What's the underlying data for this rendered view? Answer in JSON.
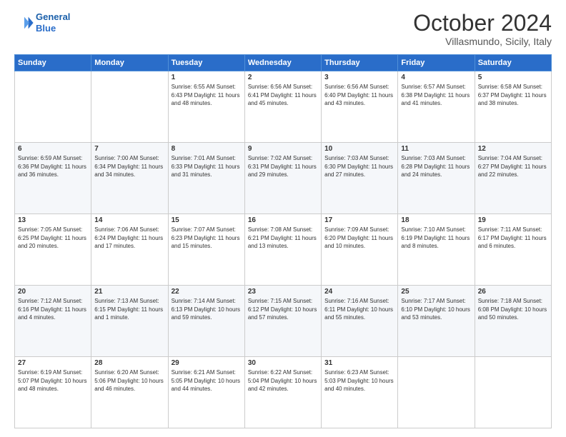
{
  "header": {
    "logo_line1": "General",
    "logo_line2": "Blue",
    "month": "October 2024",
    "location": "Villasmundo, Sicily, Italy"
  },
  "weekdays": [
    "Sunday",
    "Monday",
    "Tuesday",
    "Wednesday",
    "Thursday",
    "Friday",
    "Saturday"
  ],
  "weeks": [
    [
      {
        "day": "",
        "content": ""
      },
      {
        "day": "",
        "content": ""
      },
      {
        "day": "1",
        "content": "Sunrise: 6:55 AM\nSunset: 6:43 PM\nDaylight: 11 hours and 48 minutes."
      },
      {
        "day": "2",
        "content": "Sunrise: 6:56 AM\nSunset: 6:41 PM\nDaylight: 11 hours and 45 minutes."
      },
      {
        "day": "3",
        "content": "Sunrise: 6:56 AM\nSunset: 6:40 PM\nDaylight: 11 hours and 43 minutes."
      },
      {
        "day": "4",
        "content": "Sunrise: 6:57 AM\nSunset: 6:38 PM\nDaylight: 11 hours and 41 minutes."
      },
      {
        "day": "5",
        "content": "Sunrise: 6:58 AM\nSunset: 6:37 PM\nDaylight: 11 hours and 38 minutes."
      }
    ],
    [
      {
        "day": "6",
        "content": "Sunrise: 6:59 AM\nSunset: 6:36 PM\nDaylight: 11 hours and 36 minutes."
      },
      {
        "day": "7",
        "content": "Sunrise: 7:00 AM\nSunset: 6:34 PM\nDaylight: 11 hours and 34 minutes."
      },
      {
        "day": "8",
        "content": "Sunrise: 7:01 AM\nSunset: 6:33 PM\nDaylight: 11 hours and 31 minutes."
      },
      {
        "day": "9",
        "content": "Sunrise: 7:02 AM\nSunset: 6:31 PM\nDaylight: 11 hours and 29 minutes."
      },
      {
        "day": "10",
        "content": "Sunrise: 7:03 AM\nSunset: 6:30 PM\nDaylight: 11 hours and 27 minutes."
      },
      {
        "day": "11",
        "content": "Sunrise: 7:03 AM\nSunset: 6:28 PM\nDaylight: 11 hours and 24 minutes."
      },
      {
        "day": "12",
        "content": "Sunrise: 7:04 AM\nSunset: 6:27 PM\nDaylight: 11 hours and 22 minutes."
      }
    ],
    [
      {
        "day": "13",
        "content": "Sunrise: 7:05 AM\nSunset: 6:25 PM\nDaylight: 11 hours and 20 minutes."
      },
      {
        "day": "14",
        "content": "Sunrise: 7:06 AM\nSunset: 6:24 PM\nDaylight: 11 hours and 17 minutes."
      },
      {
        "day": "15",
        "content": "Sunrise: 7:07 AM\nSunset: 6:23 PM\nDaylight: 11 hours and 15 minutes."
      },
      {
        "day": "16",
        "content": "Sunrise: 7:08 AM\nSunset: 6:21 PM\nDaylight: 11 hours and 13 minutes."
      },
      {
        "day": "17",
        "content": "Sunrise: 7:09 AM\nSunset: 6:20 PM\nDaylight: 11 hours and 10 minutes."
      },
      {
        "day": "18",
        "content": "Sunrise: 7:10 AM\nSunset: 6:19 PM\nDaylight: 11 hours and 8 minutes."
      },
      {
        "day": "19",
        "content": "Sunrise: 7:11 AM\nSunset: 6:17 PM\nDaylight: 11 hours and 6 minutes."
      }
    ],
    [
      {
        "day": "20",
        "content": "Sunrise: 7:12 AM\nSunset: 6:16 PM\nDaylight: 11 hours and 4 minutes."
      },
      {
        "day": "21",
        "content": "Sunrise: 7:13 AM\nSunset: 6:15 PM\nDaylight: 11 hours and 1 minute."
      },
      {
        "day": "22",
        "content": "Sunrise: 7:14 AM\nSunset: 6:13 PM\nDaylight: 10 hours and 59 minutes."
      },
      {
        "day": "23",
        "content": "Sunrise: 7:15 AM\nSunset: 6:12 PM\nDaylight: 10 hours and 57 minutes."
      },
      {
        "day": "24",
        "content": "Sunrise: 7:16 AM\nSunset: 6:11 PM\nDaylight: 10 hours and 55 minutes."
      },
      {
        "day": "25",
        "content": "Sunrise: 7:17 AM\nSunset: 6:10 PM\nDaylight: 10 hours and 53 minutes."
      },
      {
        "day": "26",
        "content": "Sunrise: 7:18 AM\nSunset: 6:08 PM\nDaylight: 10 hours and 50 minutes."
      }
    ],
    [
      {
        "day": "27",
        "content": "Sunrise: 6:19 AM\nSunset: 5:07 PM\nDaylight: 10 hours and 48 minutes."
      },
      {
        "day": "28",
        "content": "Sunrise: 6:20 AM\nSunset: 5:06 PM\nDaylight: 10 hours and 46 minutes."
      },
      {
        "day": "29",
        "content": "Sunrise: 6:21 AM\nSunset: 5:05 PM\nDaylight: 10 hours and 44 minutes."
      },
      {
        "day": "30",
        "content": "Sunrise: 6:22 AM\nSunset: 5:04 PM\nDaylight: 10 hours and 42 minutes."
      },
      {
        "day": "31",
        "content": "Sunrise: 6:23 AM\nSunset: 5:03 PM\nDaylight: 10 hours and 40 minutes."
      },
      {
        "day": "",
        "content": ""
      },
      {
        "day": "",
        "content": ""
      }
    ]
  ]
}
